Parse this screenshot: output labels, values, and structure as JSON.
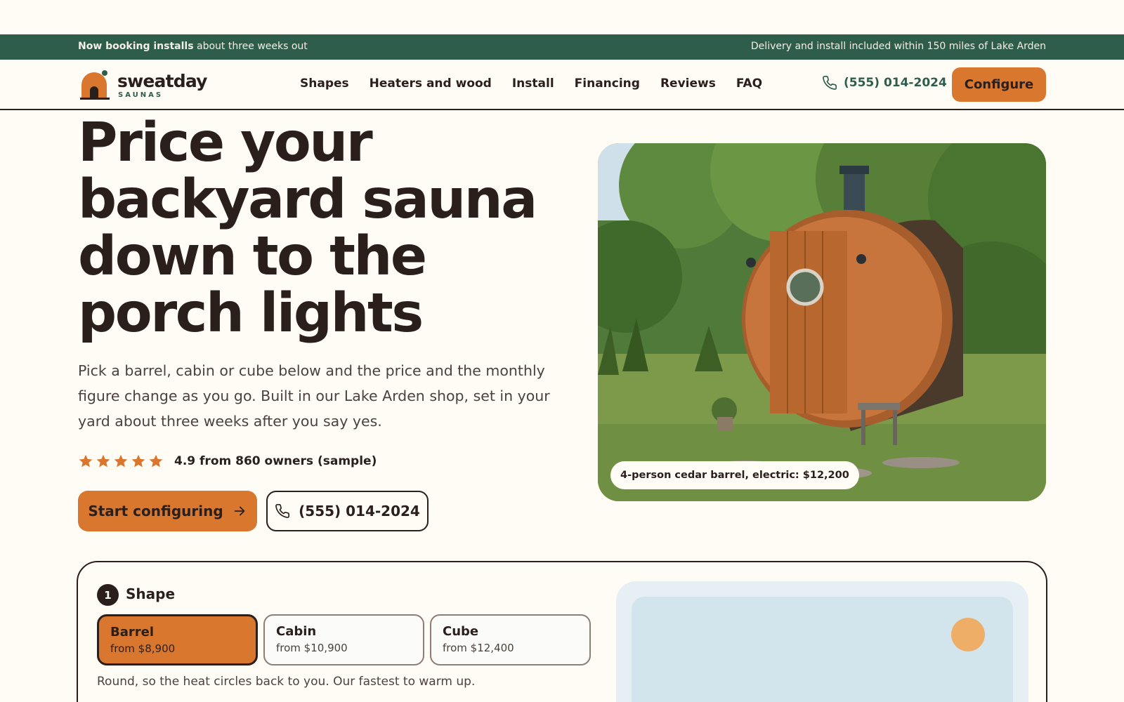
{
  "announcement": {
    "left_bold": "Now booking installs",
    "left_rest": " about three weeks out",
    "right": "Delivery and install included within 150 miles of Lake Arden"
  },
  "brand": {
    "name": "sweatday",
    "sub": "SAUNAS"
  },
  "nav": {
    "links": [
      "Shapes",
      "Heaters and wood",
      "Install",
      "Financing",
      "Reviews",
      "FAQ"
    ],
    "phone": "(555) 014-2024",
    "cta": "Configure"
  },
  "hero": {
    "title": "Price your backyard sauna down to the porch lights",
    "text": "Pick a barrel, cabin or cube below and the price and the monthly figure change as you go. Built in our Lake Arden shop, set in your yard about three weeks after you say yes.",
    "rating": {
      "stars": 5,
      "text": "4.9 from 860 owners (sample)"
    },
    "primary_button": "Start configuring",
    "secondary_button": "(555) 014-2024",
    "photo_caption": "4-person cedar barrel, electric: $12,200"
  },
  "configurator": {
    "step_number": "1",
    "step_label": "Shape",
    "shapes": [
      {
        "name": "Barrel",
        "price": "from $8,900",
        "selected": true
      },
      {
        "name": "Cabin",
        "price": "from $10,900",
        "selected": false
      },
      {
        "name": "Cube",
        "price": "from $12,400",
        "selected": false
      }
    ],
    "description": "Round, so the heat circles back to you. Our fastest to warm up."
  },
  "colors": {
    "brand_green": "#2f5d4c",
    "accent_orange": "#d9772f",
    "ink": "#2a1f1a",
    "background": "#fffcf5"
  }
}
